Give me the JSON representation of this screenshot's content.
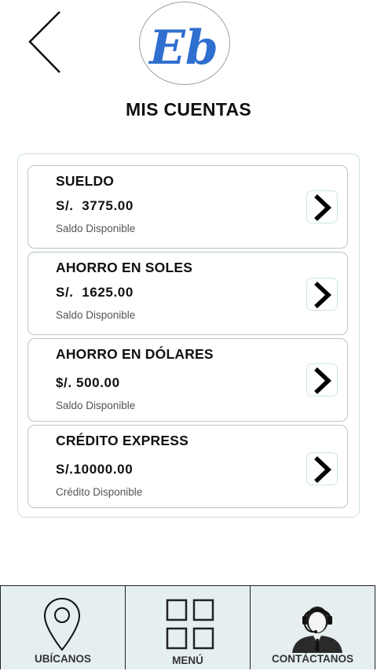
{
  "header": {
    "logo_text": "Eb",
    "title": "MIS CUENTAS"
  },
  "accounts": [
    {
      "name": "SUELDO",
      "amount": "S/.  3775.00",
      "label": "Saldo Disponible"
    },
    {
      "name": "AHORRO EN SOLES",
      "amount": "S/.  1625.00",
      "label": "Saldo Disponible"
    },
    {
      "name": "AHORRO EN DÓLARES",
      "amount": "$/. 500.00",
      "label": "Saldo Disponible"
    },
    {
      "name": "CRÉDITO EXPRESS",
      "amount": "S/.10000.00",
      "label": "Crédito Disponible"
    }
  ],
  "bottom_nav": [
    {
      "label": "UBÍCANOS",
      "icon": "location-pin-icon"
    },
    {
      "label": "MENÚ",
      "icon": "grid-menu-icon"
    },
    {
      "label": "CONTÁCTANOS",
      "icon": "support-agent-icon"
    }
  ],
  "colors": {
    "brand_blue": "#2f6fcf",
    "nav_background": "#e5eff2",
    "card_border": "#b9c4c9"
  }
}
